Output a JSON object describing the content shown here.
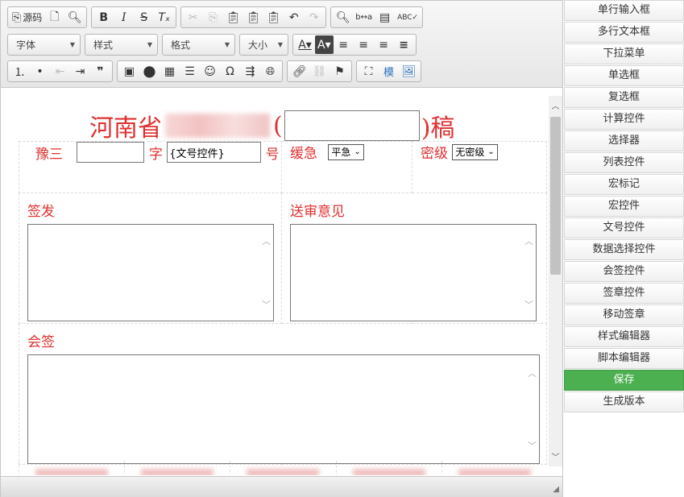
{
  "toolbar": {
    "row1": [
      {
        "name": "source-button",
        "glyph": "⎘",
        "label": "源码"
      },
      {
        "name": "new-page-button",
        "glyph": "🗋"
      },
      {
        "name": "preview-button",
        "glyph": "🔍︎"
      },
      {
        "name": "bold-button",
        "glyph": "B"
      },
      {
        "name": "italic-button",
        "glyph": "I"
      },
      {
        "name": "strike-button",
        "glyph": "S"
      },
      {
        "name": "remove-format-button",
        "glyph": "Tₓ"
      },
      {
        "name": "cut-button",
        "glyph": "✂"
      },
      {
        "name": "copy-button",
        "glyph": "⎘"
      },
      {
        "name": "paste-button",
        "glyph": "📋︎"
      },
      {
        "name": "paste-text-button",
        "glyph": "📋︎"
      },
      {
        "name": "paste-word-button",
        "glyph": "📋︎"
      },
      {
        "name": "undo-button",
        "glyph": "↶"
      },
      {
        "name": "redo-button",
        "glyph": "↷"
      },
      {
        "name": "find-button",
        "glyph": "🔍︎"
      },
      {
        "name": "replace-button",
        "glyph": "b↔a"
      },
      {
        "name": "select-all-button",
        "glyph": "▤"
      },
      {
        "name": "spellcheck-button",
        "glyph": "ABC✓"
      }
    ],
    "font_label": "字体",
    "style_label": "样式",
    "format_label": "格式",
    "size_label": "大小",
    "row2_buttons": [
      {
        "name": "text-color-button",
        "glyph": "A▾"
      },
      {
        "name": "bg-color-button",
        "glyph": "A▾"
      },
      {
        "name": "align-left-button",
        "glyph": "≡"
      },
      {
        "name": "align-center-button",
        "glyph": "≡"
      },
      {
        "name": "align-right-button",
        "glyph": "≡"
      },
      {
        "name": "align-justify-button",
        "glyph": "≡"
      }
    ],
    "row3": [
      {
        "name": "numbered-list-button",
        "glyph": "⒈"
      },
      {
        "name": "bullet-list-button",
        "glyph": "•"
      },
      {
        "name": "outdent-button",
        "glyph": "⇤"
      },
      {
        "name": "indent-button",
        "glyph": "⇥"
      },
      {
        "name": "blockquote-button",
        "glyph": "❞"
      },
      {
        "name": "image-button",
        "glyph": "▣"
      },
      {
        "name": "flash-button",
        "glyph": "⬤"
      },
      {
        "name": "table-button",
        "glyph": "▦"
      },
      {
        "name": "horizontal-rule-button",
        "glyph": "☰"
      },
      {
        "name": "smiley-button",
        "glyph": "☺"
      },
      {
        "name": "special-char-button",
        "glyph": "Ω"
      },
      {
        "name": "page-break-button",
        "glyph": "⇶"
      },
      {
        "name": "iframe-button",
        "glyph": "🌐︎"
      },
      {
        "name": "link-button",
        "glyph": "🔗︎"
      },
      {
        "name": "unlink-button",
        "glyph": "⛓"
      },
      {
        "name": "anchor-button",
        "glyph": "⚑"
      },
      {
        "name": "maximize-button",
        "glyph": "⛶"
      },
      {
        "name": "template-button",
        "glyph": "模"
      },
      {
        "name": "image-insert-button",
        "glyph": "🖼︎"
      }
    ]
  },
  "document": {
    "title_prefix": "河南省",
    "title_paren_open": "(",
    "title_paren_close": ")稿",
    "row1": {
      "label_yu": "豫三",
      "label_zi": "字",
      "doc_number_field": "{文号控件}",
      "label_hao": "号",
      "label_urgency": "缓急",
      "urgency_value": "平急",
      "label_secret": "密级",
      "secret_value": "无密级"
    },
    "label_qianfa": "签发",
    "label_songshen": "送审意见",
    "label_huiqian": "会签"
  },
  "sidebar": {
    "items": [
      "单行输入框",
      "多行文本框",
      "下拉菜单",
      "单选框",
      "复选框",
      "计算控件",
      "选择器",
      "列表控件",
      "宏标记",
      "宏控件",
      "文号控件",
      "数据选择控件",
      "会签控件",
      "签章控件",
      "移动签章",
      "样式编辑器",
      "脚本编辑器",
      "保存",
      "生成版本"
    ],
    "active_index": 17,
    "active_color": "#4caf50"
  },
  "colors": {
    "accent_red": "#e03030"
  }
}
